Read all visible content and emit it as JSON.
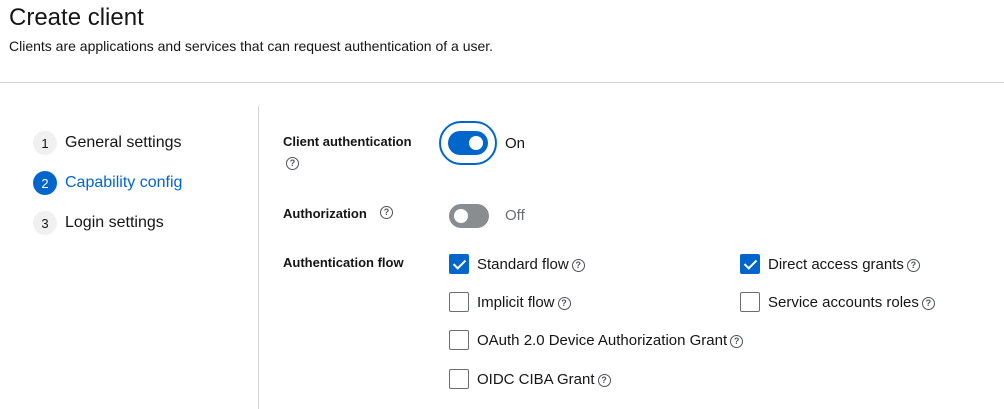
{
  "header": {
    "title": "Create client",
    "description": "Clients are applications and services that can request authentication of a user."
  },
  "wizard": {
    "steps": [
      {
        "number": "1",
        "label": "General settings",
        "current": false
      },
      {
        "number": "2",
        "label": "Capability config",
        "current": true
      },
      {
        "number": "3",
        "label": "Login settings",
        "current": false
      }
    ]
  },
  "form": {
    "help_glyph": "?",
    "client_authentication": {
      "label": "Client authentication",
      "state": "On",
      "enabled": true
    },
    "authorization": {
      "label": "Authorization",
      "state": "Off",
      "enabled": false
    },
    "authentication_flow": {
      "label": "Authentication flow",
      "options": [
        {
          "label": "Standard flow",
          "checked": true
        },
        {
          "label": "Direct access grants",
          "checked": true
        },
        {
          "label": "Implicit flow",
          "checked": false
        },
        {
          "label": "Service accounts roles",
          "checked": false
        },
        {
          "label": "OAuth 2.0 Device Authorization Grant",
          "checked": false
        },
        {
          "label": "OIDC CIBA Grant",
          "checked": false
        }
      ]
    }
  },
  "colors": {
    "accent": "#0066cc",
    "toggle_off": "#8a8d90",
    "divider": "#d2d2d2"
  },
  "icons": {
    "help": "question-circle-icon",
    "check": "checkmark-icon"
  }
}
